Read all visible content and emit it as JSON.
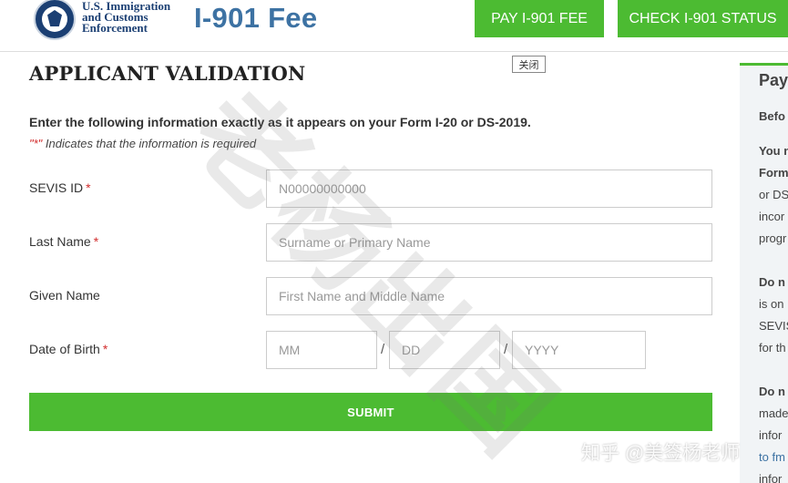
{
  "header": {
    "agency_lines": [
      "U.S. Immigration",
      "and Customs",
      "Enforcement"
    ],
    "app_title": "I-901 Fee",
    "pay_button": "PAY I-901 FEE",
    "check_button": "CHECK I-901 STATUS",
    "seal_icon": "dhs-seal-icon",
    "brand_color": "#4cbb32",
    "title_color": "#3d72a3"
  },
  "form": {
    "title": "APPLICANT VALIDATION",
    "close_badge": "关闭",
    "instructions": "Enter the following information exactly as it appears on your Form I-20 or DS-2019.",
    "required_note_star": "\"*\"",
    "required_note_text": " Indicates that the information is required",
    "required_marker": "*",
    "fields": {
      "sevis": {
        "label": "SEVIS ID",
        "placeholder": "N00000000000",
        "required": true
      },
      "last_name": {
        "label": "Last Name",
        "placeholder": "Surname or Primary Name",
        "required": true
      },
      "given_name": {
        "label": "Given Name",
        "placeholder": "First Name and Middle Name",
        "required": false
      },
      "dob": {
        "label": "Date of Birth",
        "required": true,
        "mm": "MM",
        "dd": "DD",
        "yyyy": "YYYY",
        "separator": "/"
      }
    },
    "submit_label": "SUBMIT"
  },
  "sidebar": {
    "heading": "Pay",
    "lines": [
      {
        "text": "Befo",
        "bold": true
      },
      {
        "text": "You n",
        "bold": true
      },
      {
        "text": "Form",
        "bold": true
      },
      {
        "text": "or DS",
        "bold": false
      },
      {
        "text": "incor",
        "bold": false
      },
      {
        "text": "progr",
        "bold": false
      },
      {
        "text": "Do n",
        "bold": true
      },
      {
        "text": "is on",
        "bold": false
      },
      {
        "text": "SEVIS",
        "bold": false
      },
      {
        "text": "for th",
        "bold": false
      },
      {
        "text": "Do n",
        "bold": true
      },
      {
        "text": "made",
        "bold": false
      },
      {
        "text": "infor",
        "bold": false
      },
      {
        "text": "to fm",
        "bold": false
      },
      {
        "text": "infor",
        "bold": false
      }
    ]
  },
  "watermarks": {
    "diagonal": "老杨出国",
    "zhihu": "知乎 @美签杨老师"
  }
}
